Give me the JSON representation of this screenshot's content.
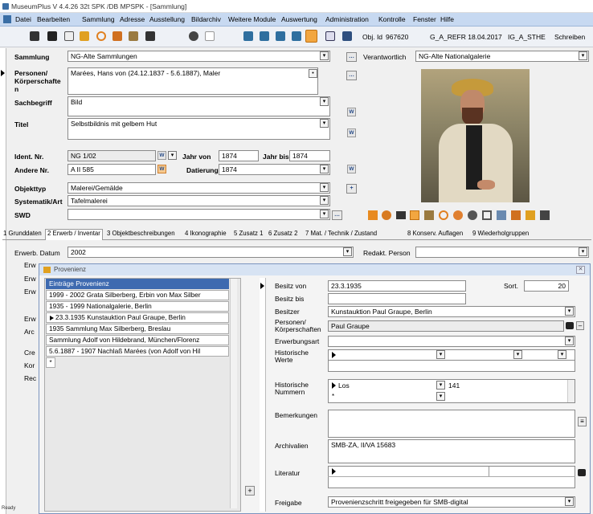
{
  "window": {
    "title": "MuseumPlus V 4.4.26 32t SPK /DB MPSPK - [Sammlung]"
  },
  "menu": [
    "Datei",
    "Bearbeiten",
    "Sammlung",
    "Adresse",
    "Ausstellung",
    "Bildarchiv",
    "Weitere Module",
    "Auswertung",
    "Administration",
    "Kontrolle",
    "Fenster",
    "Hilfe"
  ],
  "toolbar": {
    "obj_id_label": "Obj. Id",
    "obj_id": "967620",
    "ref": "G_A_REFR 18.04.2017",
    "user": "IG_A_STHE",
    "mode": "Schreiben"
  },
  "form": {
    "sammlung_label": "Sammlung",
    "sammlung": "NG-Alte Sammlungen",
    "verantw_label": "Verantwortlich",
    "verantw": "NG-Alte Nationalgalerie",
    "personen_label": "Personen/ Körperschafte n",
    "personen": "Marées, Hans von (24.12.1837 - 5.6.1887), Maler",
    "sachbegriff_label": "Sachbegriff",
    "sachbegriff": "Bild",
    "titel_label": "Titel",
    "titel": "Selbstbildnis mit gelbem Hut",
    "identnr_label": "Ident. Nr.",
    "identnr": "NG 1/02",
    "jahrvon_label": "Jahr von",
    "jahrvon": "1874",
    "jahrbis_label": "Jahr bis",
    "jahrbis": "1874",
    "anderenr_label": "Andere Nr.",
    "anderenr": "A II 585",
    "datierung_label": "Datierung",
    "datierung": "1874",
    "objekttyp_label": "Objekttyp",
    "objekttyp": "Malerei/Gemälde",
    "systematik_label": "Systematik/Art",
    "systematik": "Tafelmalerei",
    "swd_label": "SWD",
    "swd": "",
    "w_label": "W"
  },
  "tabs": [
    "1 Grunddaten",
    "2 Erwerb / Inventar",
    "3 Objektbeschreibungen",
    "4 Ikonographie",
    "5 Zusatz 1",
    "6 Zusatz 2",
    "7 Mat. / Technik / Zustand",
    "8 Konserv. Auflagen",
    "9 Wiederholgruppen"
  ],
  "erwerb": {
    "datum_label": "Erwerb. Datum",
    "datum": "2002",
    "redakt_label": "Redakt. Person",
    "redakt": "",
    "behind_labels": [
      "Erw",
      "Erw",
      "Erw",
      "Erw",
      "Arc",
      "Cre",
      "Kor",
      "Rec"
    ]
  },
  "provenienz": {
    "title": "Provenienz",
    "list_header": "Einträge Provenienz",
    "entries": [
      "1999 - 2002 Grata Silberberg, Erbin von Max Silber",
      "1935 - 1999 Nationalgalerie, Berlin",
      "23.3.1935 Kunstauktion Paul Graupe, Berlin",
      "1935 Sammlung Max Silberberg, Breslau",
      "Sammlung Adolf von Hildebrand, München/Florenz",
      "5.6.1887 - 1907 Nachlaß Marées (von Adolf von Hil"
    ],
    "besitz_von_label": "Besitz von",
    "besitz_von": "23.3.1935",
    "sort_label": "Sort.",
    "sort": "20",
    "besitz_bis_label": "Besitz bis",
    "besitz_bis": "",
    "besitzer_label": "Besitzer",
    "besitzer": "Kunstauktion Paul Graupe, Berlin",
    "personen_label": "Personen/ Körperschaften",
    "personen": "Paul Graupe",
    "erwerbungsart_label": "Erwerbungsart",
    "erwerbungsart": "",
    "hist_werte_label": "Historische Werte",
    "hist_nummern_label": "Historische Nummern",
    "hist_nr_typ": "Los",
    "hist_nr_wert": "141",
    "bemerkungen_label": "Bemerkungen",
    "bemerkungen": "",
    "archivalien_label": "Archivalien",
    "archivalien": "SMB-ZA, II/VA 15683",
    "literatur_label": "Literatur",
    "freigabe_label": "Freigabe",
    "freigabe": "Provenienzschritt freigegeben für SMB-digital"
  },
  "status": "Ready"
}
